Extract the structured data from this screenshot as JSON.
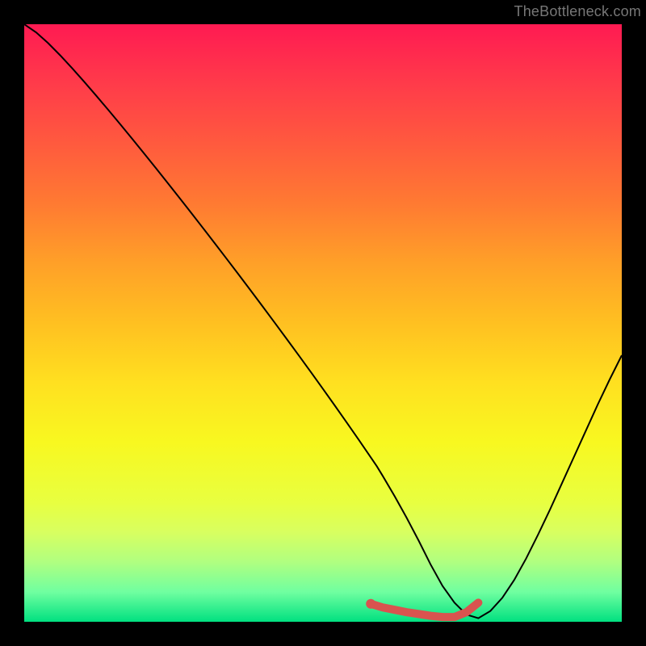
{
  "watermark": "TheBottleneck.com",
  "chart_data": {
    "type": "line",
    "title": "",
    "xlabel": "",
    "ylabel": "",
    "xlim": [
      0,
      100
    ],
    "ylim": [
      0,
      100
    ],
    "grid": false,
    "series": [
      {
        "name": "curve",
        "color": "#000000",
        "x": [
          0,
          2,
          4,
          6,
          8,
          10,
          12,
          14,
          16,
          18,
          20,
          22,
          24,
          26,
          28,
          30,
          32,
          34,
          36,
          38,
          40,
          42,
          44,
          46,
          48,
          50,
          52,
          54,
          56,
          58,
          59,
          60,
          62,
          64,
          66,
          68,
          70,
          72,
          74,
          76,
          78,
          80,
          82,
          84,
          86,
          88,
          90,
          92,
          94,
          96,
          98,
          100
        ],
        "y": [
          100,
          98.629,
          96.836,
          94.815,
          92.657,
          90.409,
          88.099,
          85.74,
          83.342,
          80.91,
          78.449,
          75.961,
          73.449,
          70.916,
          68.361,
          65.787,
          63.194,
          60.582,
          57.952,
          55.302,
          52.633,
          49.944,
          47.233,
          44.5,
          41.743,
          38.959,
          36.147,
          33.303,
          30.424,
          27.504,
          26.036,
          24.4,
          21.0,
          17.4,
          13.6,
          9.6,
          6.0,
          3.2,
          1.2,
          0.6,
          1.8,
          4.0,
          7.0,
          10.6,
          14.6,
          18.8,
          23.2,
          27.6,
          32.0,
          36.4,
          40.6,
          44.6
        ]
      },
      {
        "name": "highlight",
        "color": "#d9534f",
        "thick": true,
        "x": [
          58,
          60,
          62,
          64,
          66,
          68,
          70,
          72,
          74,
          76
        ],
        "y": [
          3.0,
          2.4,
          2.0,
          1.6,
          1.3,
          1.0,
          0.8,
          0.8,
          1.6,
          3.2
        ]
      }
    ],
    "markers": [
      {
        "name": "highlight-dot",
        "x": 58,
        "y": 3.0,
        "color": "#d9534f",
        "r": 6
      }
    ]
  }
}
